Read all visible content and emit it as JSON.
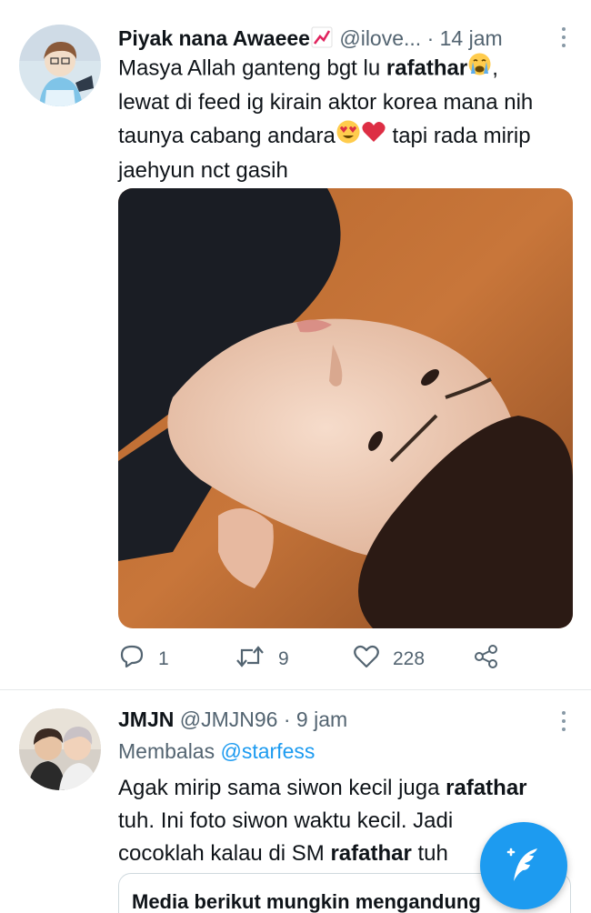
{
  "tweets": [
    {
      "name": "Piyak nana Awaeee",
      "handle": "@ilove...",
      "time": "14 jam",
      "text": {
        "l1a": "Masya Allah ganteng bgt lu ",
        "l1b": "rafathar",
        "l1c": ",",
        "l2": "lewat di feed ig kirain aktor korea mana nih",
        "l3a": "taunya cabang andara",
        "l3b": " tapi rada mirip",
        "l4": "jaehyun nct gasih"
      },
      "stats": {
        "replies": "1",
        "retweets": "9",
        "likes": "228"
      }
    },
    {
      "name": "JMJN",
      "handle": "@JMJN96",
      "time": "9 jam",
      "reply_prefix": "Membalas ",
      "reply_to": "@starfess",
      "text": {
        "l1a": "Agak mirip sama siwon kecil juga ",
        "l1b": "rafathar",
        "l2": "tuh. Ini foto siwon waktu kecil. Jadi",
        "l3a": "cocoklah kalau di SM ",
        "l3b": "rafathar",
        "l3c": " tuh"
      },
      "sensitive_warning": "Media berikut mungkin mengandung"
    }
  ],
  "separator": "·",
  "icons": {
    "reply": "reply-icon",
    "retweet": "retweet-icon",
    "like": "heart-icon",
    "share": "share-icon",
    "compose": "compose-tweet-icon",
    "more": "more-vertical-icon"
  },
  "colors": {
    "accent": "#1d9bf0",
    "secondary_text": "#536471",
    "primary_text": "#0f1419"
  }
}
